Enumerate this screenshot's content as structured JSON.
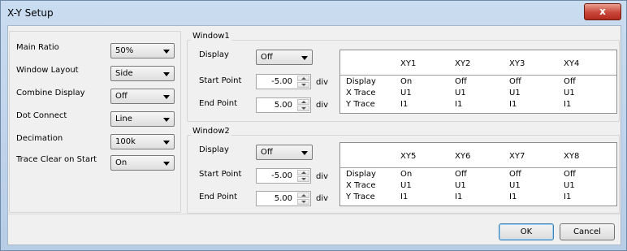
{
  "window": {
    "title": "X-Y Setup",
    "close_label": "x"
  },
  "left_settings": [
    {
      "label": "Main Ratio",
      "value": "50%"
    },
    {
      "label": "Window Layout",
      "value": "Side"
    },
    {
      "label": "Combine Display",
      "value": "Off"
    },
    {
      "label": "Dot Connect",
      "value": "Line"
    },
    {
      "label": "Decimation",
      "value": "100k"
    },
    {
      "label": "Trace Clear on Start",
      "value": "On"
    }
  ],
  "windows": [
    {
      "title": "Window1",
      "display_label": "Display",
      "display_value": "Off",
      "start_label": "Start Point",
      "start_value": "-5.00",
      "start_unit": "div",
      "end_label": "End Point",
      "end_value": "5.00",
      "end_unit": "div",
      "table": {
        "columns": [
          "XY1",
          "XY2",
          "XY3",
          "XY4"
        ],
        "rows": [
          {
            "label": "Display",
            "cells": [
              "On",
              "Off",
              "Off",
              "Off"
            ]
          },
          {
            "label": "X Trace",
            "cells": [
              "U1",
              "U1",
              "U1",
              "U1"
            ]
          },
          {
            "label": "Y Trace",
            "cells": [
              "I1",
              "I1",
              "I1",
              "I1"
            ]
          }
        ]
      }
    },
    {
      "title": "Window2",
      "display_label": "Display",
      "display_value": "Off",
      "start_label": "Start Point",
      "start_value": "-5.00",
      "start_unit": "div",
      "end_label": "End Point",
      "end_value": "5.00",
      "end_unit": "div",
      "table": {
        "columns": [
          "XY5",
          "XY6",
          "XY7",
          "XY8"
        ],
        "rows": [
          {
            "label": "Display",
            "cells": [
              "On",
              "Off",
              "Off",
              "Off"
            ]
          },
          {
            "label": "X Trace",
            "cells": [
              "U1",
              "U1",
              "U1",
              "U1"
            ]
          },
          {
            "label": "Y Trace",
            "cells": [
              "I1",
              "I1",
              "I1",
              "I1"
            ]
          }
        ]
      }
    }
  ],
  "buttons": {
    "ok": "OK",
    "cancel": "Cancel"
  }
}
